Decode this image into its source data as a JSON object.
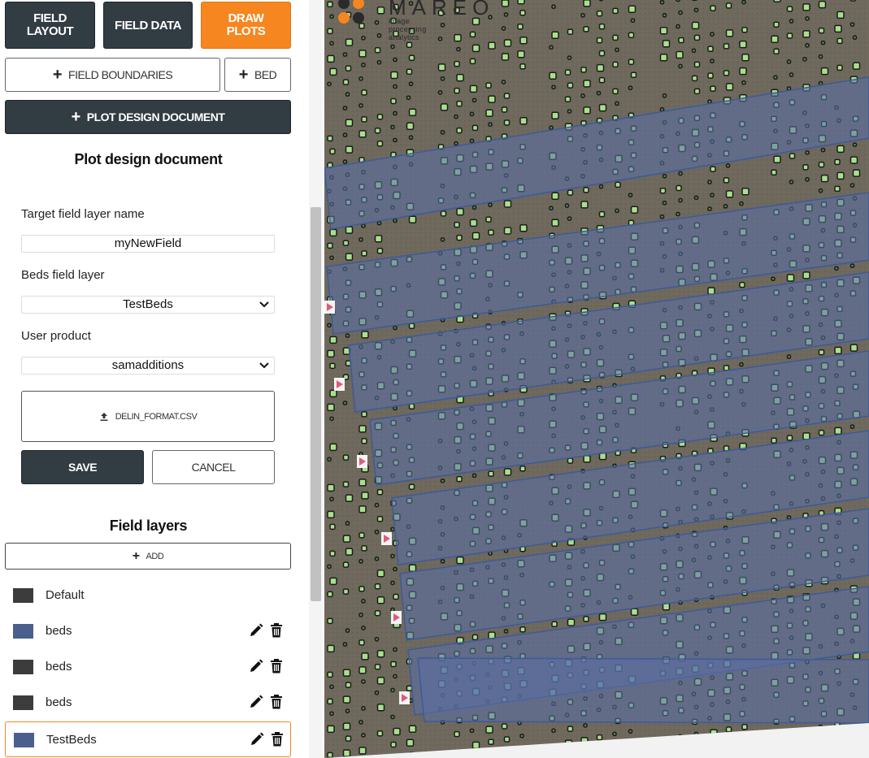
{
  "tabs": [
    {
      "label": "FIELD LAYOUT"
    },
    {
      "label": "FIELD DATA"
    },
    {
      "label": "DRAW PLOTS"
    }
  ],
  "actions": {
    "field_boundaries": "FIELD BOUNDARIES",
    "bed": "BED",
    "plot_design_document": "PLOT DESIGN DOCUMENT"
  },
  "form": {
    "heading": "Plot design document",
    "target_label": "Target field layer name",
    "target_value": "myNewField",
    "beds_label": "Beds field layer",
    "beds_value": "TestBeds",
    "product_label": "User product",
    "product_value": "samadditions",
    "file_name": "DELIN_FORMAT.CSV",
    "save": "SAVE",
    "cancel": "CANCEL"
  },
  "field_layers": {
    "heading": "Field layers",
    "add": "ADD",
    "items": [
      {
        "name": "Default",
        "color": "#3c3c3c",
        "editable": false
      },
      {
        "name": "beds",
        "color": "#4a5f8c",
        "editable": true
      },
      {
        "name": "beds",
        "color": "#3c3c3c",
        "editable": true
      },
      {
        "name": "beds",
        "color": "#3c3c3c",
        "editable": true
      },
      {
        "name": "TestBeds",
        "color": "#4a5f8c",
        "editable": true,
        "selected": true
      }
    ]
  },
  "map": {
    "logo_text": "MAREO",
    "logo_subtitle": "image processing analytics",
    "bed_fill": "#5a70a8",
    "plant_color": "#a8e08c",
    "accent": "#f6861f"
  }
}
